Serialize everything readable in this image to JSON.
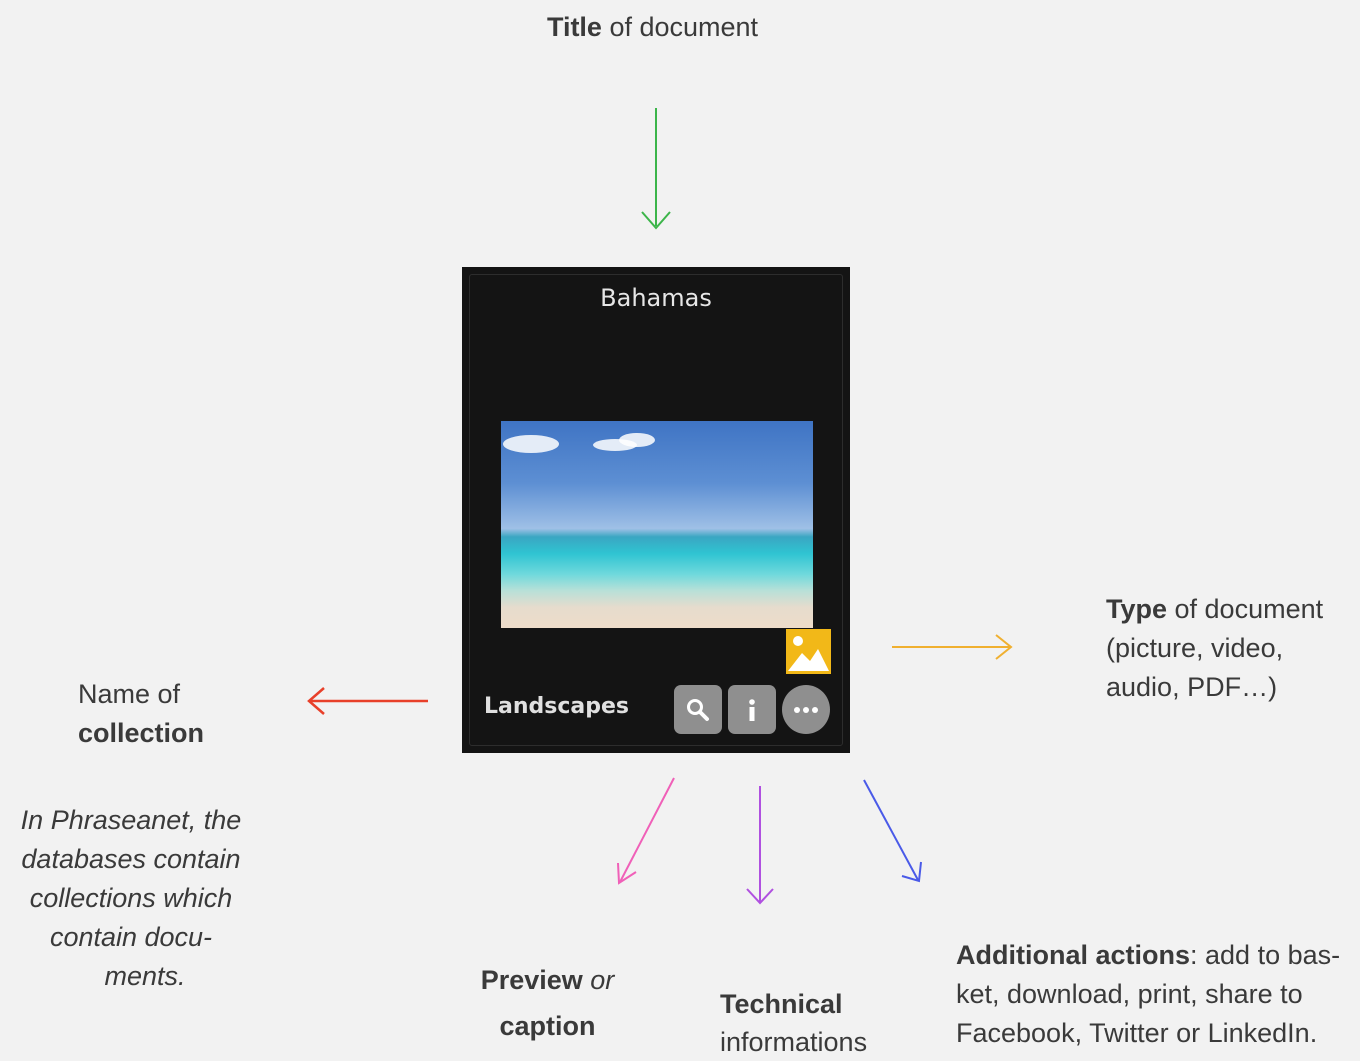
{
  "annotations": {
    "title": {
      "bold": "Title",
      "rest": " of document"
    },
    "type": {
      "bold": "Type",
      "rest": " of document",
      "line2": "(picture, video,",
      "line3": "audio, PDF…)"
    },
    "collection": {
      "line1": "Name of",
      "bold": "collection"
    },
    "collection_note": {
      "line1": "In Phraseanet, the",
      "line2": "databases contain",
      "line3": "collections which",
      "line4": "contain docu-",
      "line5": "ments."
    },
    "preview": {
      "bold1": "Preview",
      "italic": " or",
      "bold2": "caption"
    },
    "technical": {
      "bold": "Technical",
      "line2": "informations"
    },
    "actions": {
      "bold": "Additional actions",
      "rest": ": add to bas-",
      "line2": "ket, download, print, share to",
      "line3": "Facebook, Twitter or LinkedIn."
    }
  },
  "card": {
    "title": "Bahamas",
    "collection": "Landscapes",
    "type_icon": "image-icon",
    "buttons": [
      "search-icon",
      "info-icon",
      "more-icon"
    ]
  },
  "arrow_colors": {
    "title": "#3cb54a",
    "type": "#f0b030",
    "collection": "#e8402a",
    "preview": "#f060b8",
    "technical": "#b050e0",
    "actions": "#4a5ae8"
  }
}
